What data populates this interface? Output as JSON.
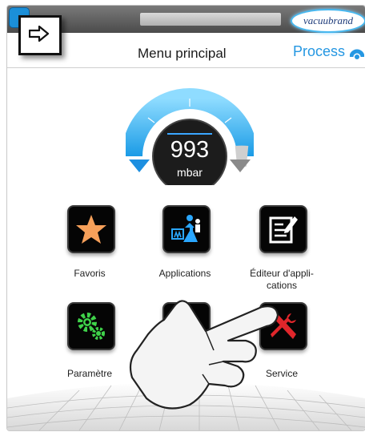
{
  "header": {
    "brand_logo_text": "vacuubrand",
    "title": "Menu principal",
    "status": "Process"
  },
  "gauge": {
    "value": "993",
    "unit": "mbar"
  },
  "tiles": [
    {
      "label": "Favoris",
      "icon": "star-icon"
    },
    {
      "label": "Applications",
      "icon": "applications-icon"
    },
    {
      "label": "Éditeur d'appli-\ncations",
      "icon": "editor-icon"
    },
    {
      "label": "Paramètre",
      "icon": "gears-icon"
    },
    {
      "label": "",
      "icon": "hidden-tile-icon"
    },
    {
      "label": "Service",
      "icon": "tools-icon"
    }
  ],
  "colors": {
    "accent_blue": "#2597e2",
    "star_orange": "#f6a05a",
    "gear_green": "#3fd24a",
    "tools_red": "#e0262b"
  }
}
